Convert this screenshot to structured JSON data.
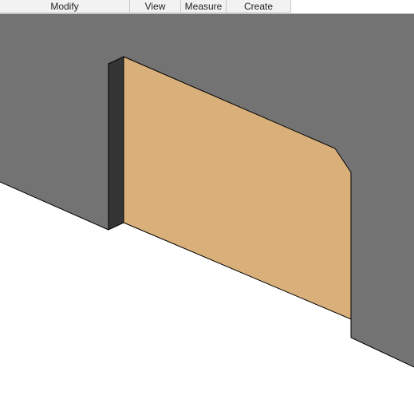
{
  "ribbon": {
    "tabs": [
      {
        "label": "Modify"
      },
      {
        "label": "View"
      },
      {
        "label": "Measure"
      },
      {
        "label": "Create"
      }
    ]
  },
  "model": {
    "colors": {
      "background": "#ffffff",
      "wall": "#737373",
      "panel_face": "#d9b07a",
      "panel_edge": "#353535",
      "outline": "#000000"
    }
  }
}
